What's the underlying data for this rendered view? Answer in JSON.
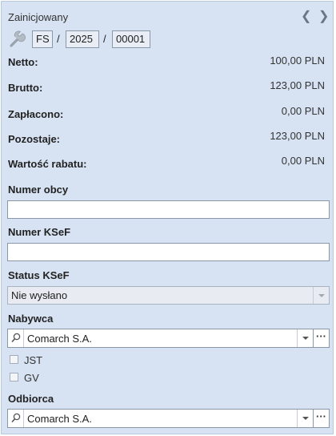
{
  "header": {
    "status": "Zainicjowany",
    "prev_icon": "chevron-left-icon",
    "next_icon": "chevron-right-icon",
    "settings_icon": "wrench-icon"
  },
  "doc_number": {
    "prefix": "FS",
    "separator": "/",
    "year": "2025",
    "number": "00001"
  },
  "totals": {
    "netto_label": "Netto:",
    "netto_value": "100,00 PLN",
    "brutto_label": "Brutto:",
    "brutto_value": "123,00 PLN",
    "paid_label": "Zapłacono:",
    "paid_value": "0,00 PLN",
    "remaining_label": "Pozostaje:",
    "remaining_value": "123,00 PLN",
    "discount_label": "Wartość rabatu:",
    "discount_value": "0,00 PLN"
  },
  "fields": {
    "external_number_label": "Numer obcy",
    "external_number_value": "",
    "ksef_number_label": "Numer KSeF",
    "ksef_number_value": "",
    "ksef_status_label": "Status KSeF",
    "ksef_status_value": "Nie wysłano"
  },
  "buyer": {
    "label": "Nabywca",
    "value": "Comarch S.A.",
    "more": "···"
  },
  "options": {
    "jst_label": "JST",
    "jst_checked": false,
    "gv_label": "GV",
    "gv_checked": false
  },
  "recipient": {
    "label": "Odbiorca",
    "value": "Comarch S.A.",
    "more": "···"
  },
  "colors": {
    "panel_bg": "#d7e3f3",
    "panel_border": "#b9c8dd"
  }
}
